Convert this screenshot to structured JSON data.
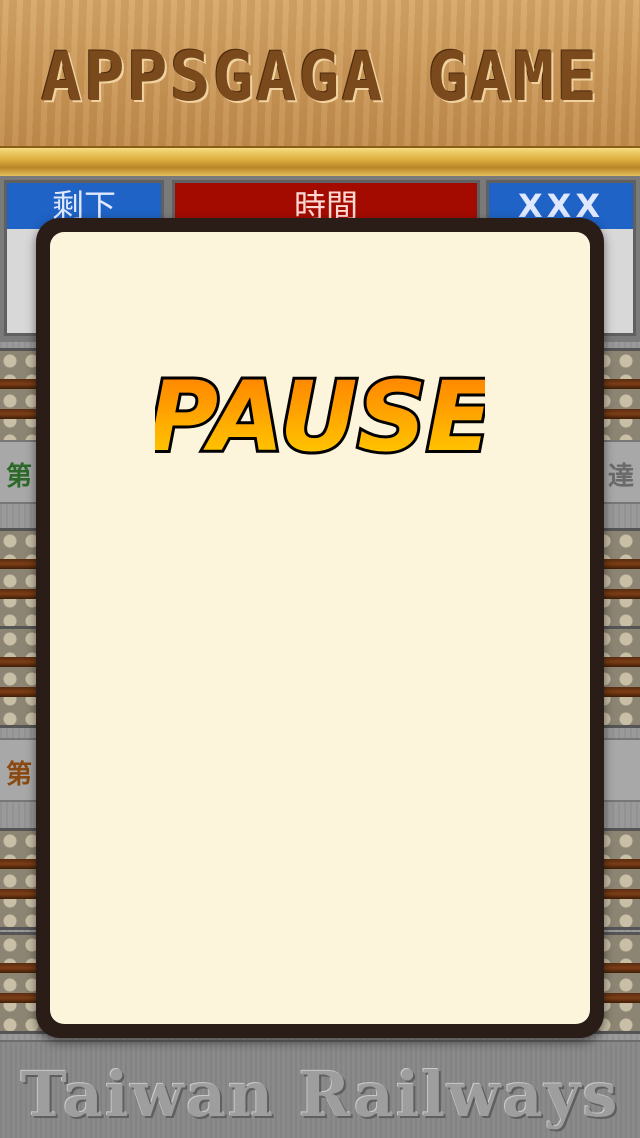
{
  "header": {
    "title": "APPSGAGA GAME"
  },
  "status": {
    "left_label": "剩下",
    "time_label": "時間",
    "right_label": "XXX"
  },
  "stations": [
    {
      "left": "第",
      "right": "達"
    },
    {
      "left": "第",
      "right": ""
    }
  ],
  "dialog": {
    "title": "PAUSE"
  },
  "footer": {
    "title": "Taiwan Railways"
  },
  "colors": {
    "pause_gradient_top": "#ff7a00",
    "pause_gradient_bottom": "#ffd400",
    "pause_outline": "#000000",
    "dialog_border": "#2a1c17",
    "dialog_fill": "#fdf4dc"
  }
}
